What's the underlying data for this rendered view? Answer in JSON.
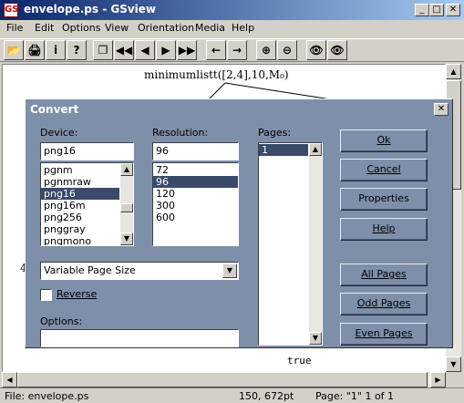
{
  "window": {
    "title": "envelope.ps - GSview",
    "icon_glyph": "GS",
    "minimize_glyph": "_",
    "maximize_glyph": "□",
    "close_glyph": "✕"
  },
  "menu": [
    "File",
    "Edit",
    "Options",
    "View",
    "Orientation",
    "Media",
    "Help"
  ],
  "toolbar": {
    "icons": [
      "open-icon",
      "print-icon",
      "info-icon",
      "help-icon",
      "copy-icon",
      "first-page-icon",
      "prev-page-icon",
      "next-page-icon",
      "last-page-icon",
      "back-icon",
      "forward-icon",
      "zoom-in-icon",
      "zoom-out-icon",
      "spellcheck-eye-icon",
      "view-eye-icon"
    ],
    "glyphs": [
      "📂",
      "🖨",
      "i",
      "?",
      "❐",
      "◀◀",
      "◀",
      "▶",
      "▶▶",
      "←",
      "→",
      "⊕",
      "⊖",
      "👁",
      "👁"
    ]
  },
  "document": {
    "formula": "minimumlistt([2,4],10,M₀)",
    "true_text": "true",
    "left_number": "4"
  },
  "status": {
    "file": "File: envelope.ps",
    "coords": "150, 672pt",
    "page": "Page: \"1\"  1 of 1"
  },
  "dialog": {
    "title": "Convert",
    "close_glyph": "✕",
    "device_label": "Device:",
    "device_value": "png16",
    "devices": [
      "pgnm",
      "pgnmraw",
      "png16",
      "png16m",
      "png256",
      "pnggray",
      "pngmono"
    ],
    "device_selected": "png16",
    "resolution_label": "Resolution:",
    "resolution_value": "96",
    "resolutions": [
      "72",
      "96",
      "120",
      "300",
      "600"
    ],
    "resolution_selected": "96",
    "pages_label": "Pages:",
    "pages": [
      "1"
    ],
    "page_size": "Variable Page Size",
    "reverse_label": "Reverse",
    "reverse_checked": false,
    "options_label": "Options:",
    "options_value": "",
    "buttons": {
      "ok": "Ok",
      "cancel": "Cancel",
      "properties": "Properties",
      "help": "Help",
      "all_pages": "All Pages",
      "odd_pages": "Odd Pages",
      "even_pages": "Even Pages"
    }
  }
}
